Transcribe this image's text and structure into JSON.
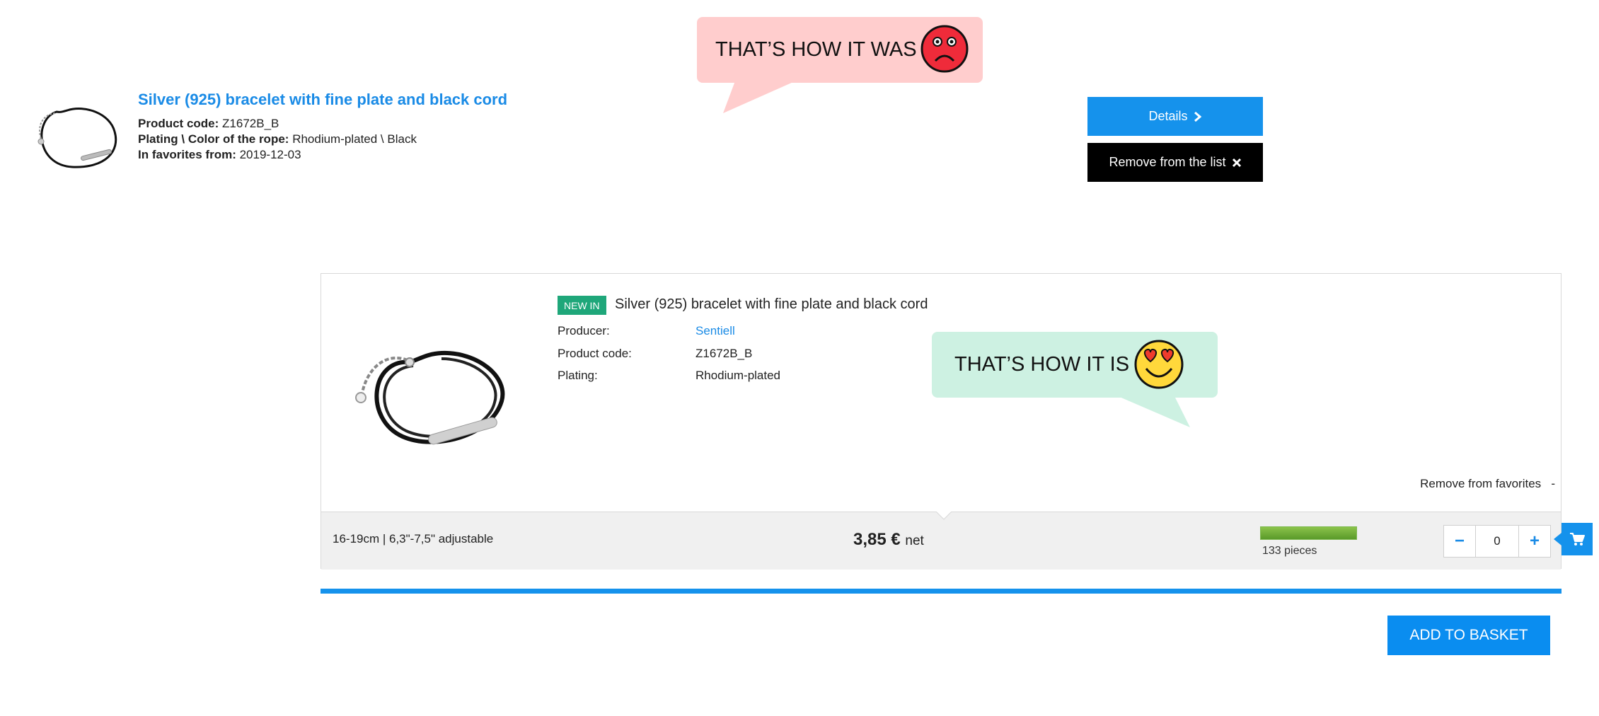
{
  "old_version": {
    "title": "Silver (925) bracelet with fine plate and black cord",
    "product_code_label": "Product code:",
    "product_code_value": "Z1672B_B",
    "plating_label": "Plating \\ Color of the rope:",
    "plating_value": "Rhodium-plated \\ Black",
    "favorites_label": "In favorites from:",
    "favorites_value": "2019-12-03",
    "details_button": "Details",
    "remove_button": "Remove from the list"
  },
  "bubbles": {
    "was_text": "THAT’S HOW IT WAS",
    "is_text": "THAT’S HOW IT IS",
    "was_color": "#ffcdcd",
    "is_color": "#cdf1e2"
  },
  "new_version": {
    "badge": "NEW IN",
    "title": "Silver (925) bracelet with fine plate and black cord",
    "producer_label": "Producer:",
    "producer_value": "Sentiell",
    "product_code_label": "Product code:",
    "product_code_value": "Z1672B_B",
    "plating_label": "Plating:",
    "plating_value": "Rhodium-plated",
    "remove_favorites": "Remove from favorites",
    "remove_favorites_icon": "-",
    "size": "16-19cm | 6,3\"-7,5\" adjustable",
    "price_amount": "3,85 €",
    "price_suffix": "net",
    "stock_text": "133 pieces",
    "quantity_value": "0",
    "minus_label": "−",
    "plus_label": "+",
    "add_to_basket": "ADD TO BASKET"
  },
  "colors": {
    "accent_blue": "#1592ec",
    "badge_green": "#1fa77a",
    "stock_green": "#6fae35"
  },
  "icons": [
    "sad-face-icon",
    "heart-eyes-face-icon",
    "chevron-right-icon",
    "close-x-icon",
    "cart-icon"
  ]
}
